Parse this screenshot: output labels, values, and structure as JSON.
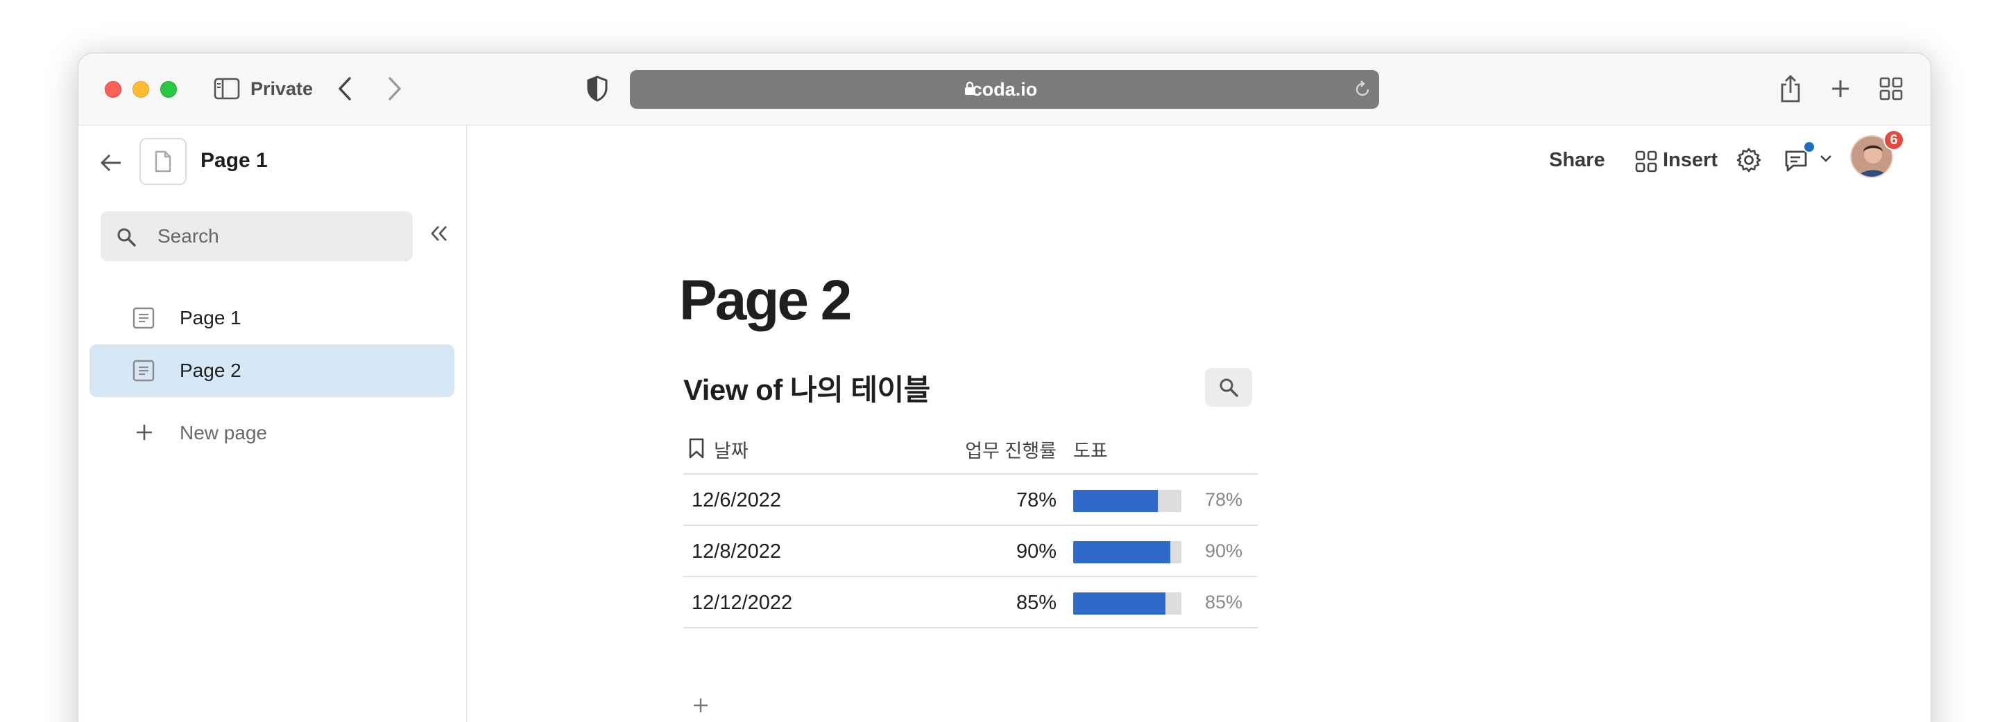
{
  "browser": {
    "mode_label": "Private",
    "url": "coda.io"
  },
  "sidebar": {
    "doc_title": "Page 1",
    "search": {
      "placeholder": "Search",
      "value": ""
    },
    "pages": [
      {
        "label": "Page 1",
        "active": false
      },
      {
        "label": "Page 2",
        "active": true
      }
    ],
    "new_page_label": "New page"
  },
  "topbar": {
    "share_label": "Share",
    "insert_label": "Insert",
    "notification_count": "6"
  },
  "page": {
    "title": "Page 2",
    "table": {
      "title": "View of 나의 테이블",
      "columns": [
        "날짜",
        "업무 진행률",
        "도표"
      ],
      "rows": [
        {
          "date": "12/6/2022",
          "progress_text": "78%",
          "progress": 0.78,
          "chart_label": "78%"
        },
        {
          "date": "12/8/2022",
          "progress_text": "90%",
          "progress": 0.9,
          "chart_label": "90%"
        },
        {
          "date": "12/12/2022",
          "progress_text": "85%",
          "progress": 0.85,
          "chart_label": "85%"
        }
      ],
      "bar_color": "#2f6acb",
      "bar_track_color": "#dcdcdc"
    }
  },
  "colors": {
    "active_nav_bg": "#d6e8f5",
    "badge": "#e8473b",
    "comment_dot": "#1c6fc0"
  },
  "icons": [
    "close-window-icon",
    "minimize-icon",
    "fullscreen-icon",
    "sidebar-toggle-icon",
    "back-icon",
    "forward-icon",
    "shield-icon",
    "lock-icon",
    "reload-icon",
    "share-icon",
    "new-tab-icon",
    "tab-overview-icon",
    "arrow-left-icon",
    "document-icon",
    "search-icon",
    "collapse-icon",
    "page-icon",
    "plus-icon",
    "insert-icon",
    "gear-icon",
    "comments-icon",
    "chevron-down-icon",
    "bookmark-icon"
  ]
}
